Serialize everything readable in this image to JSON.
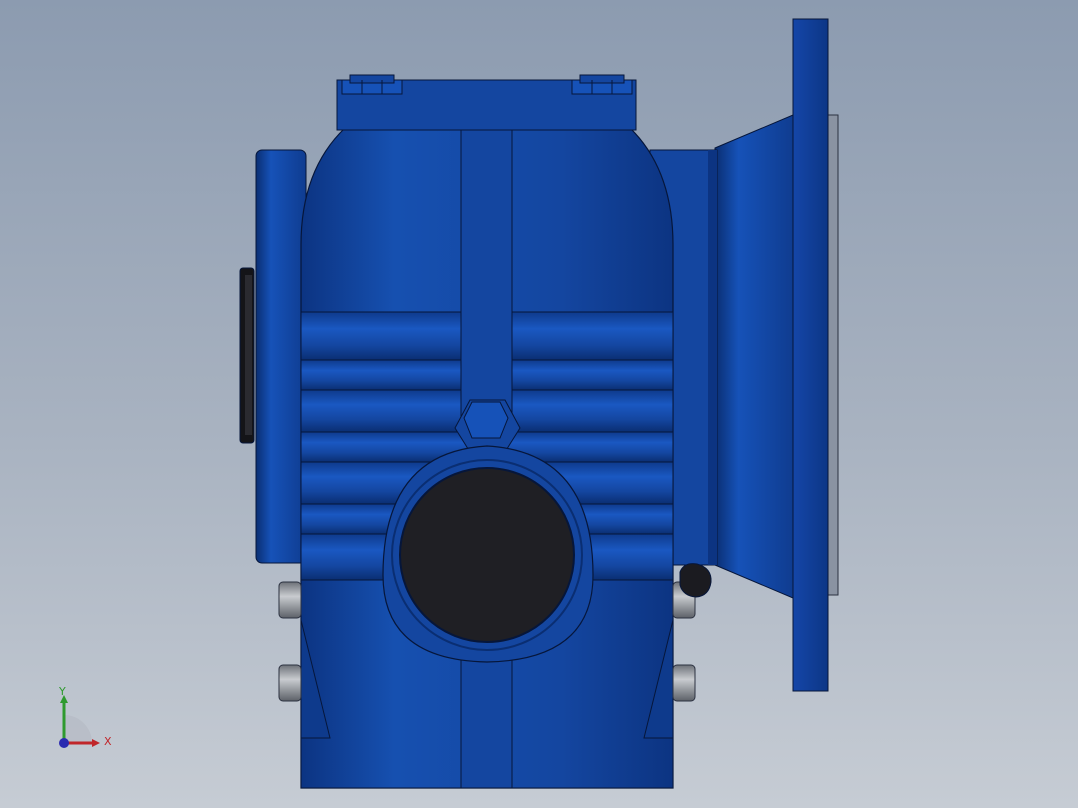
{
  "viewport": {
    "background_top": "#8c9bb0",
    "background_bottom": "#c6ccd4"
  },
  "model": {
    "part_color": "#1446a0",
    "shaft_bore_color": "#1f1f24",
    "bolt_color": "#8e9298"
  },
  "triad": {
    "x_label": "X",
    "y_label": "Y",
    "x_color": "#c0262a",
    "y_color": "#2e9a2e",
    "z_color": "#2a2ab0"
  }
}
